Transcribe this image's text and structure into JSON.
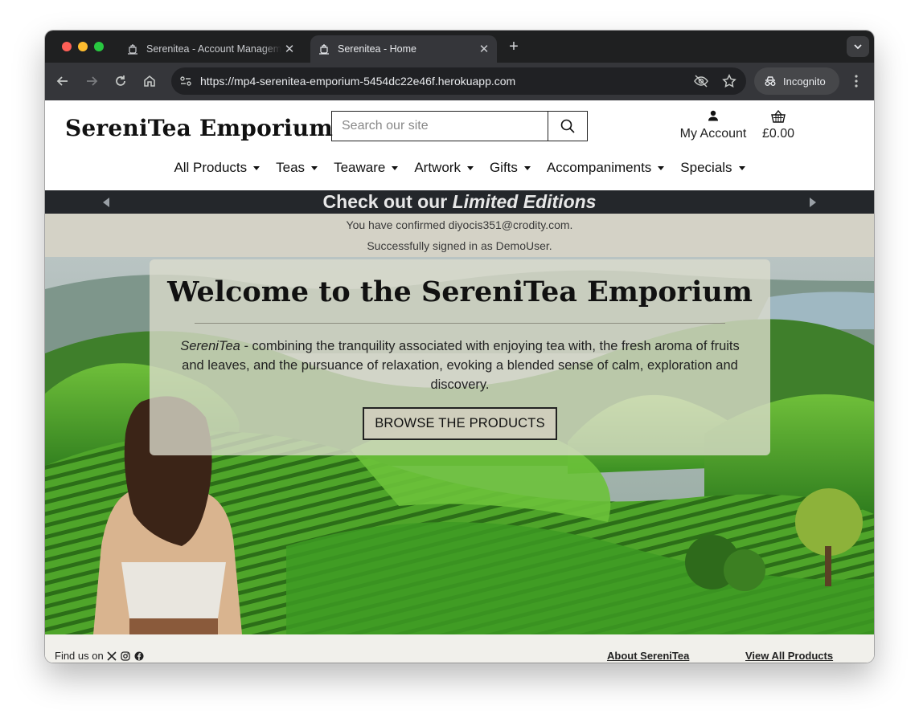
{
  "browser": {
    "tabs": [
      {
        "title": "Serenitea - Account Management",
        "active": false
      },
      {
        "title": "Serenitea - Home",
        "active": true
      }
    ],
    "url": "https://mp4-serenitea-emporium-5454dc22e46f.herokuapp.com",
    "incognito_label": "Incognito",
    "icons": [
      "back-icon",
      "forward-icon",
      "reload-icon",
      "home-icon",
      "site-info-icon",
      "eye-off-icon",
      "star-icon",
      "incognito-icon",
      "menu-kebab-icon",
      "new-tab-icon",
      "tab-search-icon"
    ]
  },
  "header": {
    "logo": "SereniTea Emporium",
    "search_placeholder": "Search our site",
    "account_label": "My Account",
    "basket_total": "£0.00"
  },
  "nav": {
    "items": [
      "All Products",
      "Teas",
      "Teaware",
      "Artwork",
      "Gifts",
      "Accompaniments",
      "Specials"
    ]
  },
  "banner": {
    "text_prefix": "Check out our ",
    "text_emphasis": "Limited Editions"
  },
  "messages": [
    "You have confirmed diyocis351@crodity.com.",
    "Successfully signed in as DemoUser."
  ],
  "hero": {
    "title": "Welcome to the SereniTea Emporium",
    "brand_italic": "SereniTea",
    "description": " - combining the tranquility associated with enjoying tea with, the fresh aroma of fruits and leaves, and the pursuance of relaxation, evoking a blended sense of calm, exploration and discovery.",
    "button_label": "BROWSE THE PRODUCTS"
  },
  "footer": {
    "find_us": "Find us on",
    "about_link": "About SereniTea",
    "all_products_link": "View All Products"
  },
  "colors": {
    "banner_bg": "#24272b",
    "messages_bg": "#d4d2c6",
    "footer_bg": "#f1f0eb"
  }
}
